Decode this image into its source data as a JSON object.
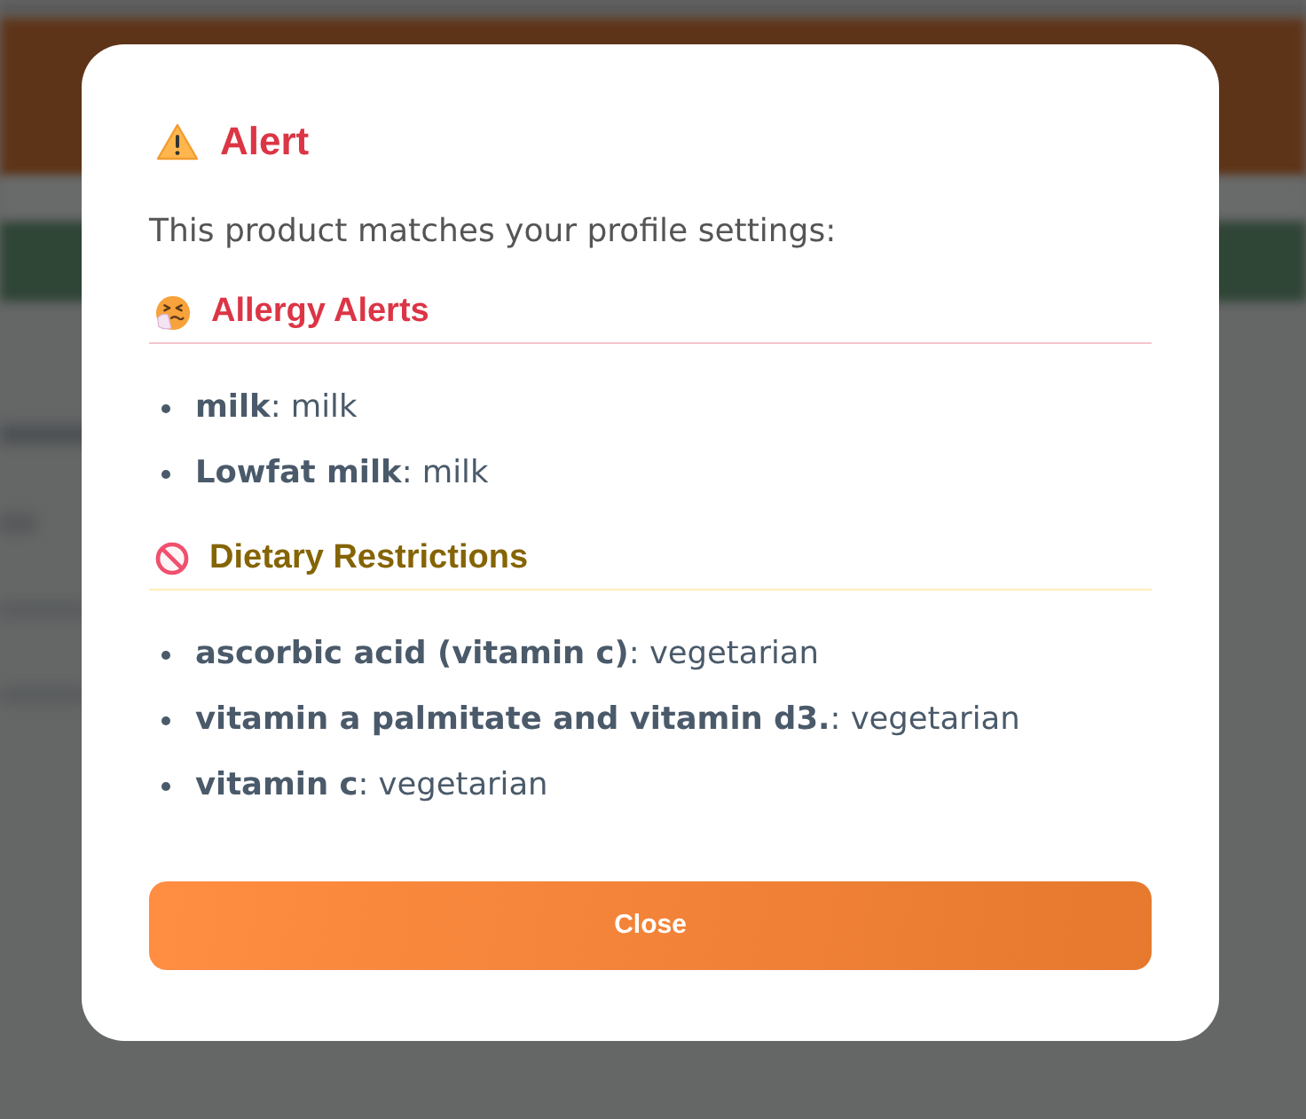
{
  "alert": {
    "title": "Alert",
    "message": "This product matches your profile settings:",
    "sections": [
      {
        "kind": "allergy",
        "heading": "Allergy Alerts",
        "items": [
          "**milk**: milk",
          "**Lowfat milk**: milk"
        ]
      },
      {
        "kind": "dietary",
        "heading": "Dietary Restrictions",
        "items": [
          "**ascorbic acid (vitamin c)**: vegetarian",
          "**vitamin a palmitate and vitamin d3.**: vegetarian",
          "**vitamin c**: vegetarian"
        ]
      }
    ],
    "close_button": "Close"
  }
}
